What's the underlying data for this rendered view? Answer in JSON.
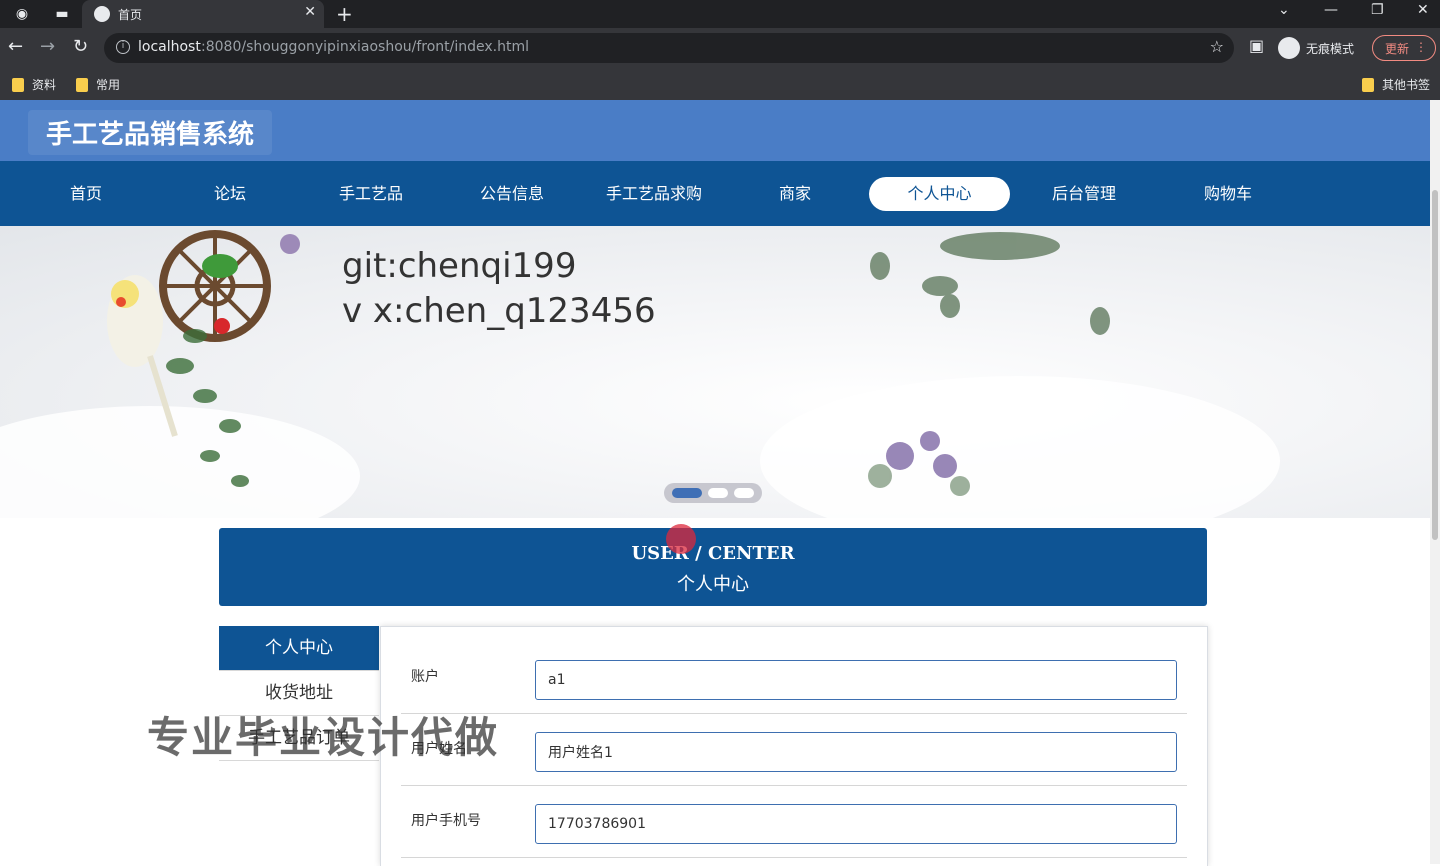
{
  "browser": {
    "tab_title": "首页",
    "url_host": "localhost",
    "url_path": ":8080/shouggonyipinxiaoshou/front/index.html",
    "profile_label": "无痕模式",
    "update_label": "更新",
    "bookmarks": [
      "资料",
      "常用"
    ],
    "other_bookmarks": "其他书签"
  },
  "site": {
    "title": "手工艺品销售系统",
    "nav": [
      {
        "label": "首页"
      },
      {
        "label": "论坛"
      },
      {
        "label": "手工艺品"
      },
      {
        "label": "公告信息"
      },
      {
        "label": "手工艺品求购"
      },
      {
        "label": "商家"
      },
      {
        "label": "个人中心",
        "active": true
      },
      {
        "label": "后台管理"
      },
      {
        "label": "购物车"
      }
    ],
    "colors": {
      "header": "#4a7dc6",
      "nav": "#0e5494",
      "accent": "#3e6fb0"
    }
  },
  "banner": {
    "line1": "git:chenqi199",
    "line2": "v x:chen_q123456",
    "active_slide": 1,
    "slide_count": 3
  },
  "user_center": {
    "title_en": "USER / CENTER",
    "title_cn": "个人中心",
    "side_menu": [
      {
        "label": "个人中心",
        "active": true
      },
      {
        "label": "收货地址"
      },
      {
        "label": "手工艺品订单"
      }
    ],
    "form": [
      {
        "label": "账户",
        "value": "a1"
      },
      {
        "label": "用户姓名",
        "value": "用户姓名1"
      },
      {
        "label": "用户手机号",
        "value": "17703786901"
      }
    ]
  },
  "overlay": {
    "watermark": "专业毕业设计代做"
  }
}
